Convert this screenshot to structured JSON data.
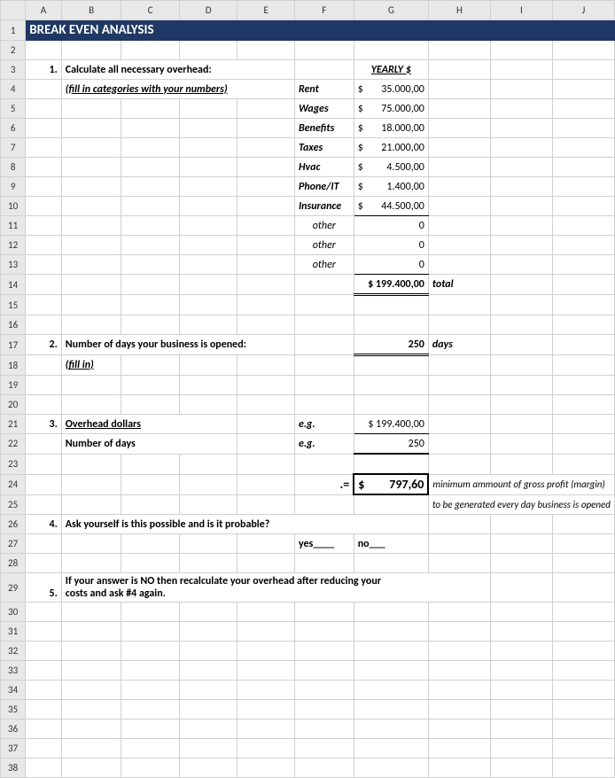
{
  "title": "BREAK EVEN ANALYSIS",
  "cols": [
    "",
    "A",
    "B",
    "C",
    "D",
    "E",
    "F",
    "G",
    "H",
    "I",
    "J"
  ],
  "step1": {
    "num": "1.",
    "heading": "Calculate all necessary overhead:",
    "hint": "(fill in categories with your numbers)",
    "yearly_label": "YEARLY  $",
    "items": [
      {
        "label": "Rent",
        "cur": "$",
        "val": "35.000,00"
      },
      {
        "label": "Wages",
        "cur": "$",
        "val": "75.000,00"
      },
      {
        "label": "Benefits",
        "cur": "$",
        "val": "18.000,00"
      },
      {
        "label": "Taxes",
        "cur": "$",
        "val": "21.000,00"
      },
      {
        "label": "Hvac",
        "cur": "$",
        "val": "4.500,00"
      },
      {
        "label": "Phone/IT",
        "cur": "$",
        "val": "1.400,00"
      },
      {
        "label": "Insurance",
        "cur": "$",
        "val": "44.500,00"
      },
      {
        "label": "other",
        "cur": "",
        "val": "0"
      },
      {
        "label": "other",
        "cur": "",
        "val": "0"
      },
      {
        "label": "other",
        "cur": "",
        "val": "0"
      }
    ],
    "total_val": "$ 199.400,00",
    "total_label": "total"
  },
  "step2": {
    "num": "2.",
    "heading": "Number of days your business is opened:",
    "hint": "(fill in)",
    "val": "250",
    "unit": "days"
  },
  "step3": {
    "num": "3.",
    "row_a": "Overhead dollars",
    "row_b": "Number of days",
    "eg": "e.g.",
    "val_a": "$ 199.400,00",
    "val_b": "250",
    "eq": ".=",
    "result_cur": "$",
    "result_val": "797,60",
    "note1": "minimum ammount of gross profit (margin)",
    "note2": "to be generated every day business is opened"
  },
  "step4": {
    "num": "4.",
    "heading": "Ask yourself is this possible and is it probable?",
    "yes": "yes____",
    "no": "no___"
  },
  "step5": {
    "num": "5.",
    "line1": "If your answer is NO then recalculate your overhead after reducing your",
    "line2": "costs and ask #4 again."
  },
  "chart_data": {
    "type": "table",
    "overhead_items": [
      {
        "category": "Rent",
        "yearly_usd": 35000.0
      },
      {
        "category": "Wages",
        "yearly_usd": 75000.0
      },
      {
        "category": "Benefits",
        "yearly_usd": 18000.0
      },
      {
        "category": "Taxes",
        "yearly_usd": 21000.0
      },
      {
        "category": "Hvac",
        "yearly_usd": 4500.0
      },
      {
        "category": "Phone/IT",
        "yearly_usd": 1400.0
      },
      {
        "category": "Insurance",
        "yearly_usd": 44500.0
      },
      {
        "category": "other",
        "yearly_usd": 0
      },
      {
        "category": "other",
        "yearly_usd": 0
      },
      {
        "category": "other",
        "yearly_usd": 0
      }
    ],
    "total_overhead_usd": 199400.0,
    "days_open": 250,
    "break_even_per_day_usd": 797.6
  }
}
